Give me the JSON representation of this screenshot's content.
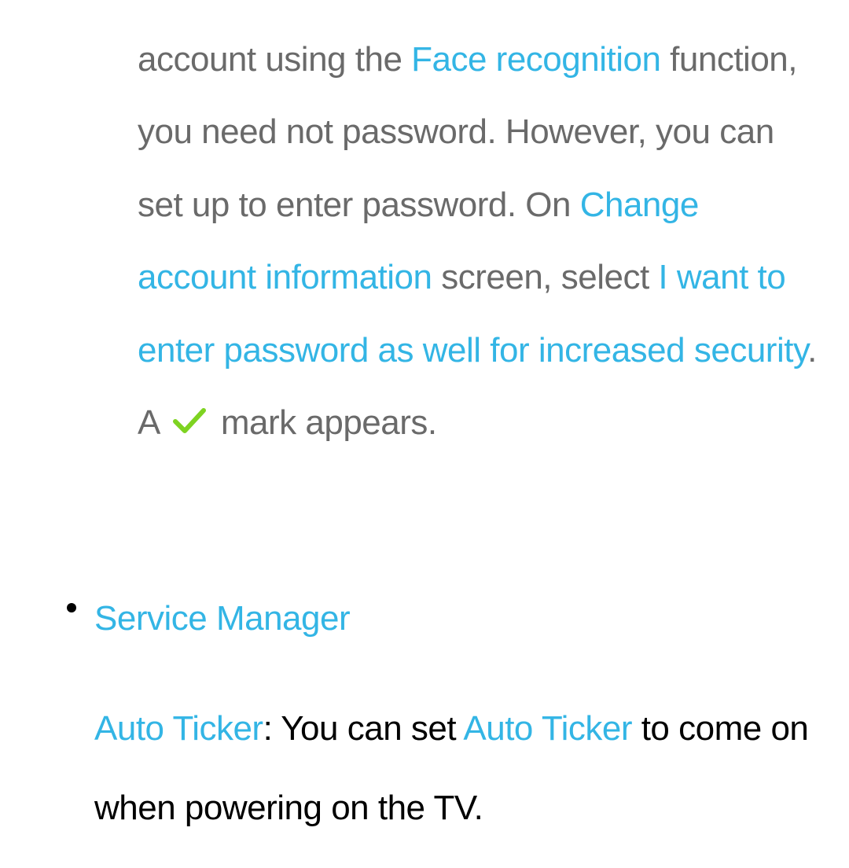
{
  "paragraph1": {
    "pre_link1": "account using the ",
    "link1": "Face recognition",
    "mid1": " function, you need not password. However, you can set up to enter password. On ",
    "link2": "Change account information",
    "mid2": " screen, select ",
    "link3": "I want to enter password as well for increased security",
    "post1": ". A ",
    "post2": " mark appears."
  },
  "bullet": {
    "heading": "Service Manager",
    "body_link1": "Auto Ticker",
    "body_text1": ": You can set ",
    "body_link2": "Auto Ticker",
    "body_text2": " to come on when powering on the TV."
  }
}
